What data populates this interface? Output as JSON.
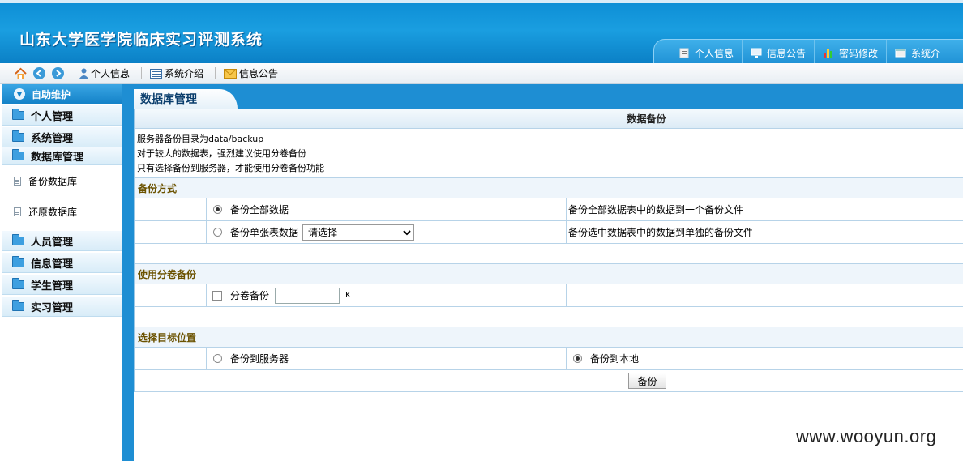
{
  "header": {
    "title": "山东大学医学院临床实习评测系统",
    "nav": [
      {
        "label": "个人信息",
        "icon": "document-icon"
      },
      {
        "label": "信息公告",
        "icon": "monitor-icon"
      },
      {
        "label": "密码修改",
        "icon": "bar-chart-icon"
      },
      {
        "label": "系统介",
        "icon": "window-icon"
      }
    ]
  },
  "toolbar": {
    "links": [
      {
        "label": "个人信息",
        "icon": "user-icon"
      },
      {
        "label": "系统介绍",
        "icon": "list-icon"
      },
      {
        "label": "信息公告",
        "icon": "envelope-icon"
      }
    ]
  },
  "sidebar": {
    "header": "自助维护",
    "categories": [
      {
        "label": "个人管理"
      },
      {
        "label": "系统管理"
      },
      {
        "label": "数据库管理",
        "items": [
          "备份数据库",
          "还原数据库"
        ]
      },
      {
        "label": "人员管理"
      },
      {
        "label": "信息管理"
      },
      {
        "label": "学生管理"
      },
      {
        "label": "实习管理"
      }
    ]
  },
  "main": {
    "tab": "数据库管理",
    "table_title": "数据备份",
    "info_lines": [
      "服务器备份目录为data/backup",
      "对于较大的数据表，强烈建议使用分卷备份",
      "只有选择备份到服务器，才能使用分卷备份功能"
    ],
    "section_mode": "备份方式",
    "option_all": {
      "label": "备份全部数据",
      "desc": "备份全部数据表中的数据到一个备份文件",
      "selected": true
    },
    "option_single": {
      "label": "备份单张表数据",
      "desc": "备份选中数据表中的数据到单独的备份文件",
      "selected": false,
      "select_value": "请选择"
    },
    "section_volume": "使用分卷备份",
    "volume": {
      "label": "分卷备份",
      "checked": false,
      "value": "",
      "unit": "K"
    },
    "section_target": "选择目标位置",
    "target_server": {
      "label": "备份到服务器",
      "selected": false
    },
    "target_local": {
      "label": "备份到本地",
      "selected": true
    },
    "submit": "备份"
  },
  "watermark": "www.wooyun.org"
}
